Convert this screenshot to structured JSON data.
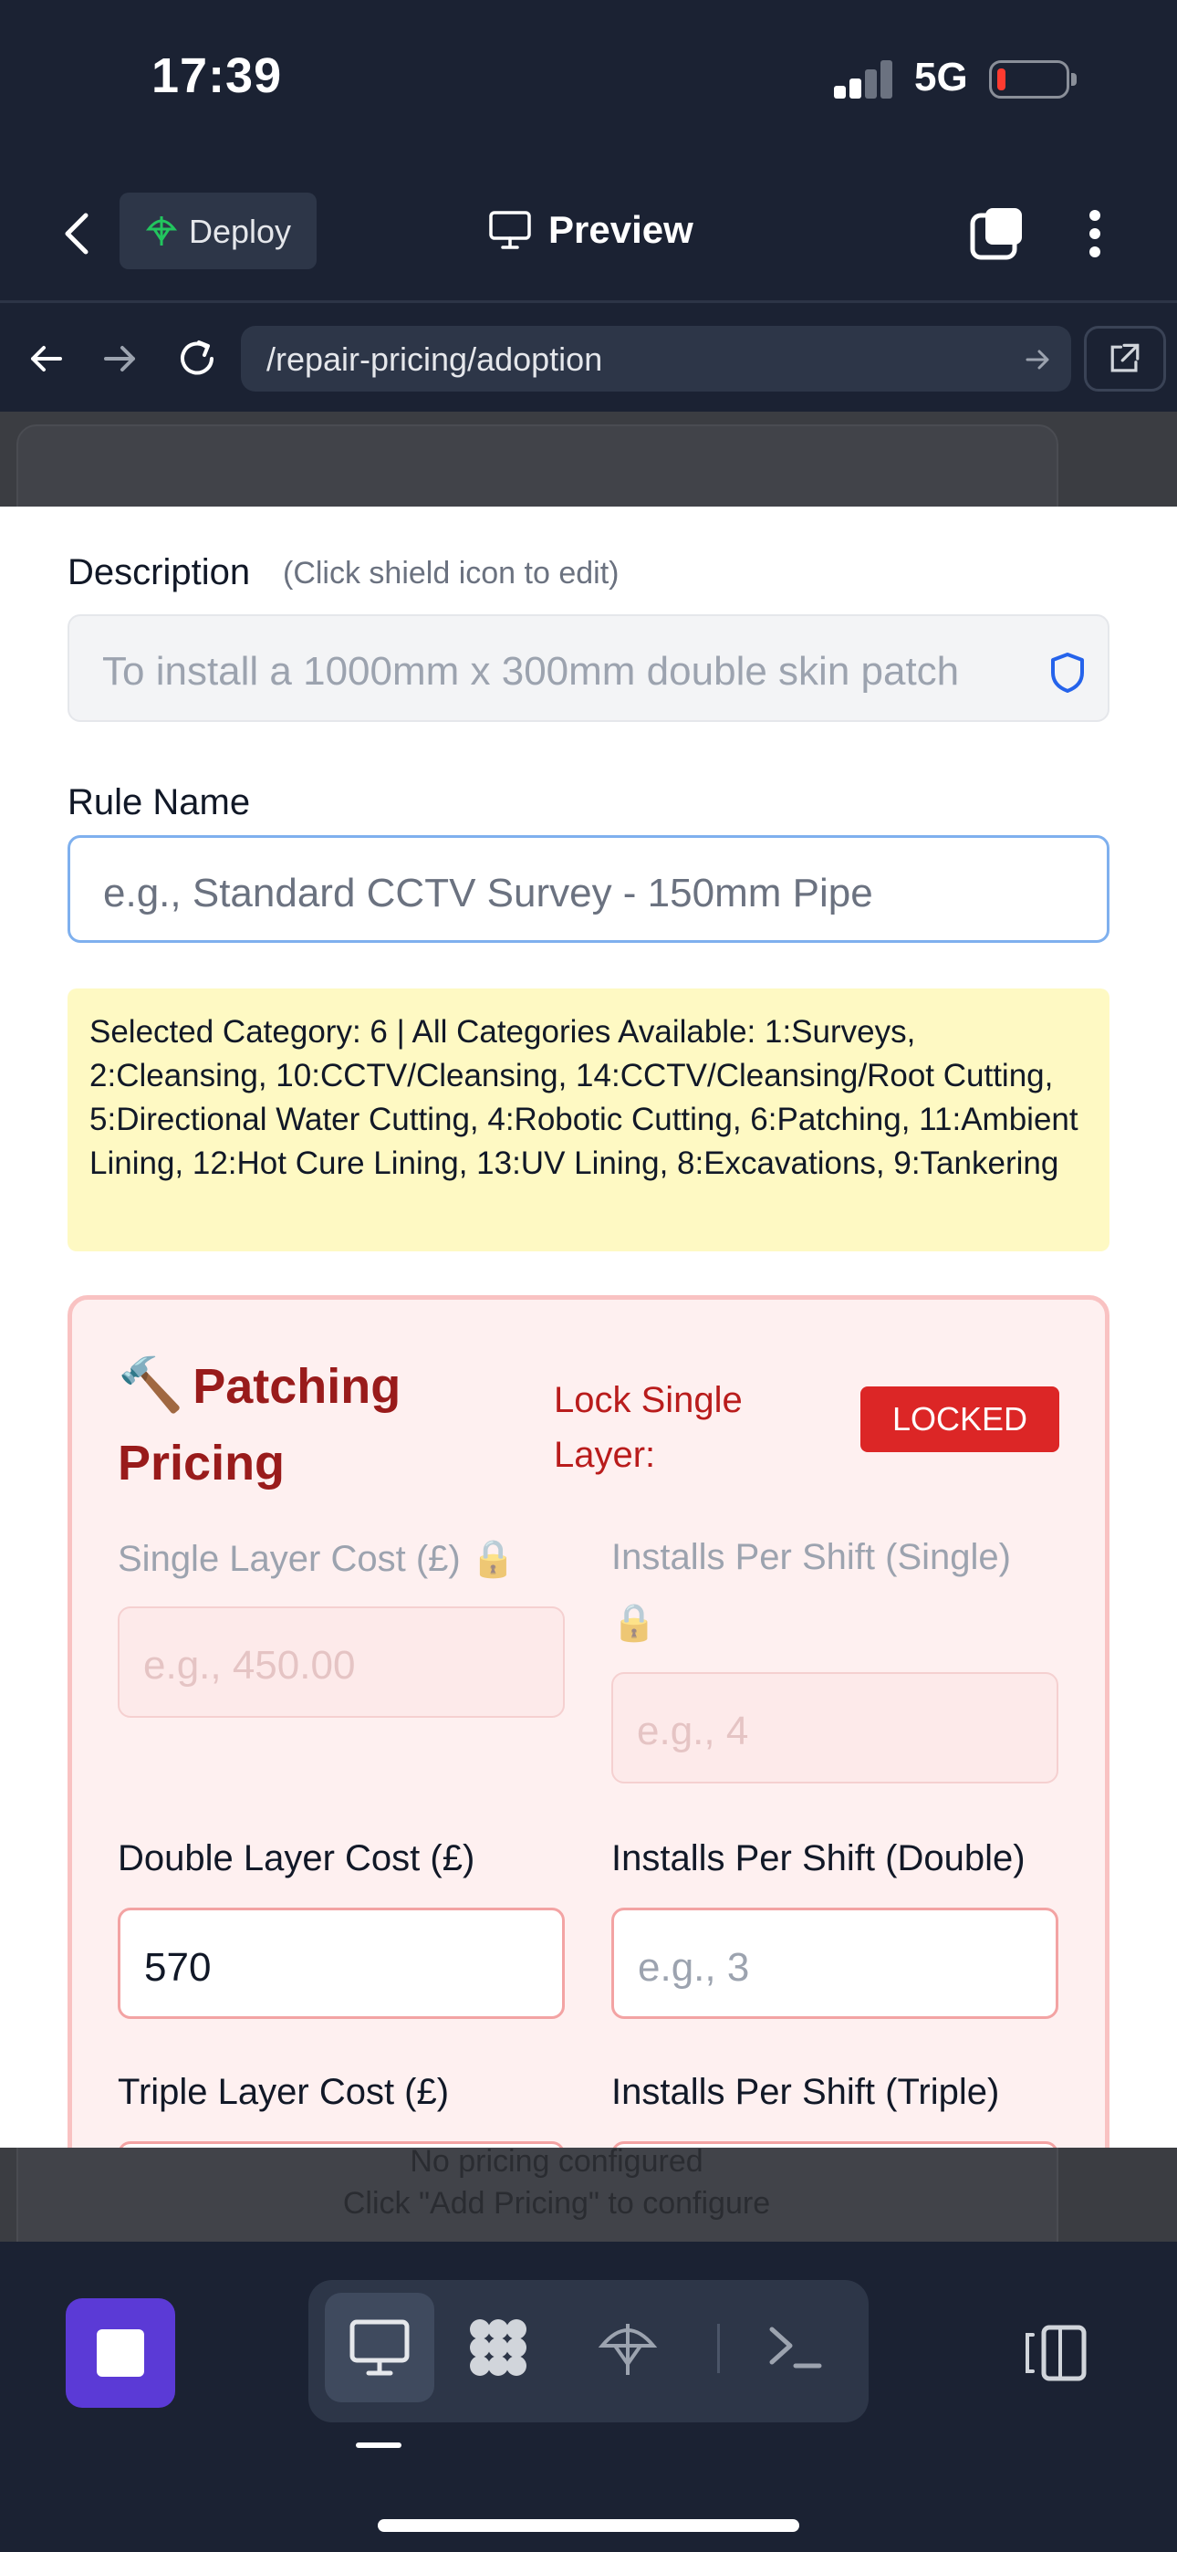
{
  "status_bar": {
    "time": "17:39",
    "network": "5G"
  },
  "header": {
    "deploy_label": "Deploy",
    "preview_label": "Preview"
  },
  "browser": {
    "url": "/repair-pricing/adoption"
  },
  "background_page": {
    "empty_line1": "No pricing configured",
    "empty_line2": "Click \"Add Pricing\" to configure"
  },
  "form": {
    "description_label": "Description",
    "description_hint": "(Click shield icon to edit)",
    "description_value": "To install a 1000mm x 300mm double skin patch",
    "rule_name_label": "Rule Name",
    "rule_name_placeholder": "e.g., Standard CCTV Survey - 150mm Pipe",
    "category_info": "Selected Category: 6 | All Categories Available: 1:Surveys, 2:Cleansing, 10:CCTV/Cleansing, 14:CCTV/Cleansing/Root Cutting, 5:Directional Water Cutting, 4:Robotic Cutting, 6:Patching, 11:Ambient Lining, 12:Hot Cure Lining, 13:UV Lining, 8:Excavations, 9:Tankering"
  },
  "pricing": {
    "title_icon": "🔨",
    "title": "Patching Pricing",
    "lock_label": "Lock Single Layer:",
    "lock_status": "LOCKED",
    "lock_icon": "🔒",
    "single_cost_label": "Single Layer Cost (£)",
    "single_cost_placeholder": "e.g., 450.00",
    "single_installs_label": "Installs Per Shift (Single)",
    "single_installs_placeholder": "e.g., 4",
    "double_cost_label": "Double Layer Cost (£)",
    "double_cost_value": "570",
    "double_installs_label": "Installs Per Shift (Double)",
    "double_installs_placeholder": "e.g., 3",
    "triple_cost_label": "Triple Layer Cost (£)",
    "triple_installs_label": "Installs Per Shift (Triple)"
  },
  "colors": {
    "accent": "#5b3ad6",
    "danger": "#dc2626",
    "panel": "#1b2233"
  }
}
